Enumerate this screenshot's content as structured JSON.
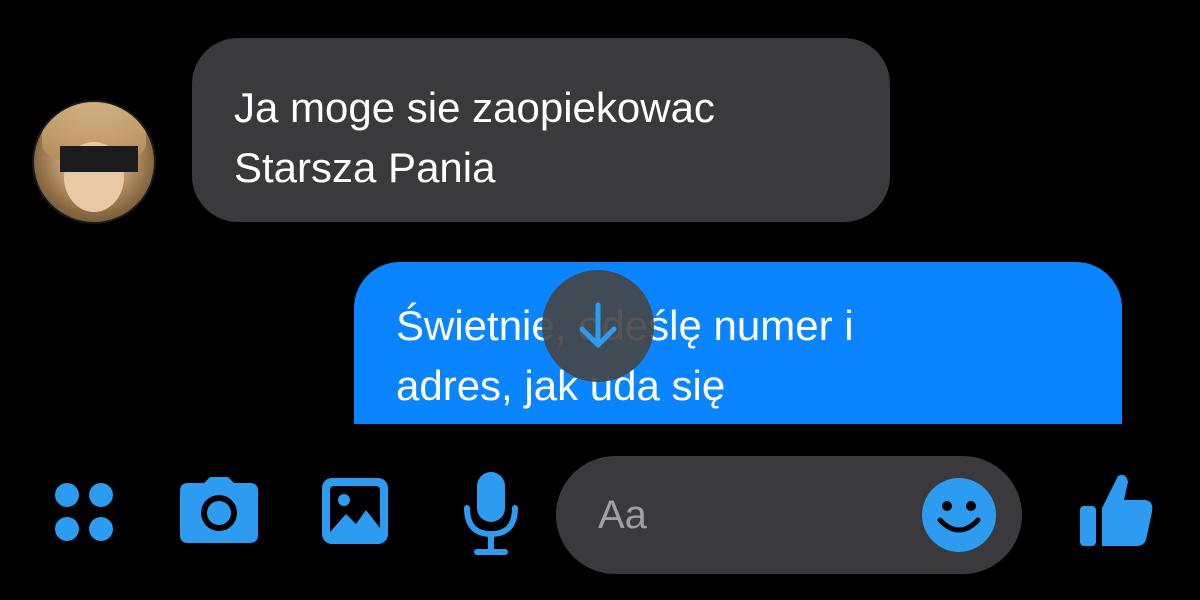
{
  "colors": {
    "background": "#000000",
    "incoming_bubble": "#3a3a3c",
    "outgoing_bubble": "#0a84ff",
    "accent": "#2d9cf0",
    "text": "#ffffff",
    "placeholder": "#a0a0a4"
  },
  "messages": [
    {
      "direction": "incoming",
      "text": "Ja moge sie zaopiekowac\nStarsza Pania"
    },
    {
      "direction": "outgoing",
      "text": "Świetnie, odeślę numer i\nadres, jak uda się"
    }
  ],
  "composer": {
    "placeholder": "Aa",
    "icons": [
      "apps-icon",
      "camera-icon",
      "gallery-icon",
      "microphone-icon",
      "emoji-icon",
      "like-icon"
    ]
  },
  "scroll_button": {
    "icon": "arrow-down-icon"
  }
}
